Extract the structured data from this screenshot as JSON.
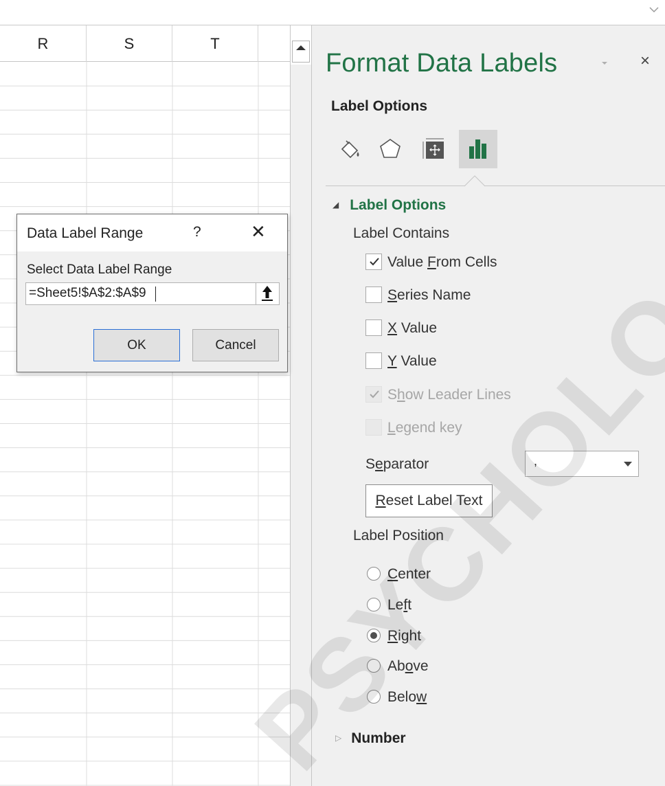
{
  "sheet": {
    "columns": [
      "R",
      "S",
      "T"
    ]
  },
  "pane": {
    "title": "Format Data Labels",
    "subtitle": "Label Options",
    "section_label_options": "Label Options",
    "label_contains": "Label Contains",
    "checkboxes": [
      {
        "pre": "Value ",
        "u": "F",
        "post": "rom Cells",
        "checked": true,
        "enabled": true
      },
      {
        "pre": "",
        "u": "S",
        "post": "eries Name",
        "checked": false,
        "enabled": true
      },
      {
        "pre": "",
        "u": "X",
        "post": " Value",
        "checked": false,
        "enabled": true
      },
      {
        "pre": "",
        "u": "Y",
        "post": " Value",
        "checked": false,
        "enabled": true
      },
      {
        "pre": "S",
        "u": "h",
        "post": "ow Leader Lines",
        "checked": true,
        "enabled": false
      },
      {
        "pre": "",
        "u": "L",
        "post": "egend key",
        "checked": false,
        "enabled": false
      }
    ],
    "separator": {
      "pre": "S",
      "u": "e",
      "post": "parator",
      "value": ","
    },
    "reset_button": {
      "pre": "",
      "u": "R",
      "post": "eset Label Text"
    },
    "label_position": "Label Position",
    "positions": [
      {
        "pre": "",
        "u": "C",
        "post": "enter",
        "selected": false
      },
      {
        "pre": "Le",
        "u": "f",
        "post": "t",
        "selected": false
      },
      {
        "pre": "",
        "u": "R",
        "post": "ight",
        "selected": true
      },
      {
        "pre": "Ab",
        "u": "o",
        "post": "ve",
        "selected": false
      },
      {
        "pre": "Belo",
        "u": "w",
        "post": "",
        "selected": false
      }
    ],
    "number_section": "Number",
    "close_glyph": "×"
  },
  "dialog": {
    "title": "Data Label Range",
    "help": "?",
    "close": "✕",
    "prompt": "Select Data Label Range",
    "range_value": "=Sheet5!$A$2:$A$9",
    "ok_label": "OK",
    "cancel_label": "Cancel"
  },
  "watermark": {
    "text": "PSYCHOLOGY"
  },
  "colors": {
    "accent": "#217346",
    "pane_bg": "#f0f0f0",
    "ok_border": "#2a6fd6"
  }
}
